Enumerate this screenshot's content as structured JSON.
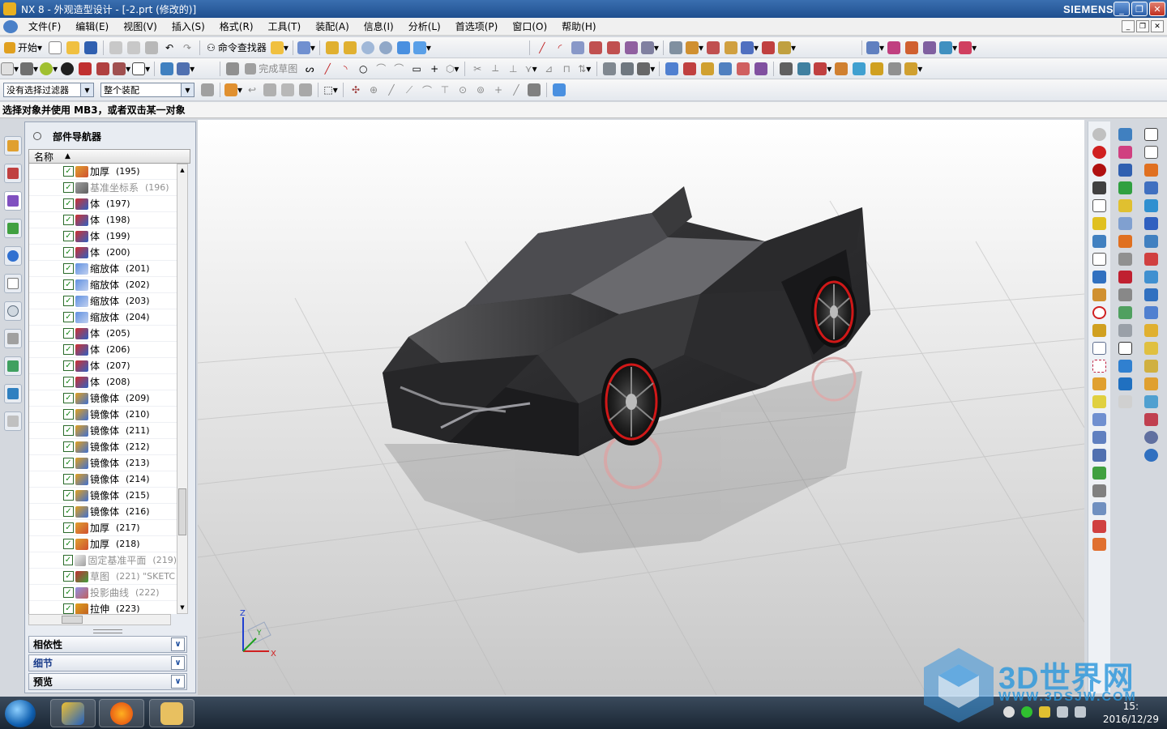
{
  "window": {
    "title": "NX 8 - 外观造型设计 - [-2.prt (修改的)]",
    "brand": "SIEMENS",
    "controls": [
      "minimize",
      "restore",
      "close"
    ]
  },
  "menubar": {
    "items": [
      "文件(F)",
      "编辑(E)",
      "视图(V)",
      "插入(S)",
      "格式(R)",
      "工具(T)",
      "装配(A)",
      "信息(I)",
      "分析(L)",
      "首选项(P)",
      "窗口(O)",
      "帮助(H)"
    ]
  },
  "toolbar1": {
    "start_label": "开始",
    "command_finder_label": "命令查找器"
  },
  "toolbar2": {
    "finish_sketch_label": "完成草图"
  },
  "selection_bar": {
    "filter_value": "没有选择过滤器",
    "scope_value": "整个装配"
  },
  "cue_line": "选择对象并使用 MB3，或者双击某一对象",
  "navigator": {
    "title": "部件导航器",
    "column_header": "名称",
    "rows": [
      {
        "label": "加厚",
        "num": "(195)",
        "icon": "thicken-icon",
        "grey": false
      },
      {
        "label": "基准坐标系",
        "num": "(196)",
        "icon": "datum-csys-icon",
        "grey": true
      },
      {
        "label": "体",
        "num": "(197)",
        "icon": "body-icon",
        "grey": false
      },
      {
        "label": "体",
        "num": "(198)",
        "icon": "body-icon",
        "grey": false
      },
      {
        "label": "体",
        "num": "(199)",
        "icon": "body-icon",
        "grey": false
      },
      {
        "label": "体",
        "num": "(200)",
        "icon": "body-icon",
        "grey": false
      },
      {
        "label": "缩放体",
        "num": "(201)",
        "icon": "scale-body-icon",
        "grey": false
      },
      {
        "label": "缩放体",
        "num": "(202)",
        "icon": "scale-body-icon",
        "grey": false
      },
      {
        "label": "缩放体",
        "num": "(203)",
        "icon": "scale-body-icon",
        "grey": false
      },
      {
        "label": "缩放体",
        "num": "(204)",
        "icon": "scale-body-icon",
        "grey": false
      },
      {
        "label": "体",
        "num": "(205)",
        "icon": "body-icon",
        "grey": false
      },
      {
        "label": "体",
        "num": "(206)",
        "icon": "body-icon",
        "grey": false
      },
      {
        "label": "体",
        "num": "(207)",
        "icon": "body-icon",
        "grey": false
      },
      {
        "label": "体",
        "num": "(208)",
        "icon": "body-icon",
        "grey": false
      },
      {
        "label": "镜像体",
        "num": "(209)",
        "icon": "mirror-body-icon",
        "grey": false
      },
      {
        "label": "镜像体",
        "num": "(210)",
        "icon": "mirror-body-icon",
        "grey": false
      },
      {
        "label": "镜像体",
        "num": "(211)",
        "icon": "mirror-body-icon",
        "grey": false
      },
      {
        "label": "镜像体",
        "num": "(212)",
        "icon": "mirror-body-icon",
        "grey": false
      },
      {
        "label": "镜像体",
        "num": "(213)",
        "icon": "mirror-body-icon",
        "grey": false
      },
      {
        "label": "镜像体",
        "num": "(214)",
        "icon": "mirror-body-icon",
        "grey": false
      },
      {
        "label": "镜像体",
        "num": "(215)",
        "icon": "mirror-body-icon",
        "grey": false
      },
      {
        "label": "镜像体",
        "num": "(216)",
        "icon": "mirror-body-icon",
        "grey": false
      },
      {
        "label": "加厚",
        "num": "(217)",
        "icon": "thicken-icon",
        "grey": false
      },
      {
        "label": "加厚",
        "num": "(218)",
        "icon": "thicken-icon",
        "grey": false
      },
      {
        "label": "固定基准平面",
        "num": "(219)",
        "icon": "datum-plane-icon",
        "grey": true
      },
      {
        "label": "草图",
        "num": "(221) \"SKETC",
        "icon": "sketch-icon",
        "grey": true
      },
      {
        "label": "投影曲线",
        "num": "(222)",
        "icon": "project-curve-icon",
        "grey": true
      },
      {
        "label": "拉伸",
        "num": "(223)",
        "icon": "extrude-icon",
        "grey": false
      }
    ],
    "panels": [
      "相依性",
      "细节",
      "预览"
    ]
  },
  "triad": {
    "x": "X",
    "y": "Y",
    "z": "Z"
  },
  "taskbar": {
    "time": "15:",
    "date": "2016/12/29"
  },
  "watermark": {
    "title": "3D世界网",
    "url": "WWW.3DSJW.COM"
  },
  "colors": {
    "titlebar": "#1f4f8f",
    "check": "#1c8a1c",
    "car_body": "#2e2e30",
    "wheel_rim": "#d01818"
  }
}
